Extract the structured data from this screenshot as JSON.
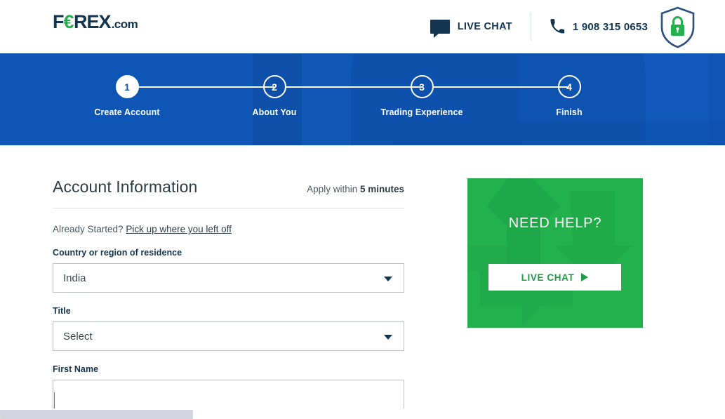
{
  "brand": {
    "logo_main_1": "F",
    "logo_euro": "€",
    "logo_main_2": "REX",
    "logo_dotcom": ".com",
    "blue": "#0e55b5",
    "navy": "#13354f",
    "green": "#22b14c"
  },
  "header": {
    "live_chat_label": "LIVE CHAT",
    "phone_number": "1 908 315 0653",
    "chat_icon": "chat-bubble-icon",
    "phone_icon": "phone-icon",
    "secure_icon": "shield-lock-icon"
  },
  "stepper": {
    "steps": [
      {
        "number": "1",
        "label": "Create Account",
        "active": true
      },
      {
        "number": "2",
        "label": "About You",
        "active": false
      },
      {
        "number": "3",
        "label": "Trading Experience",
        "active": false
      },
      {
        "number": "4",
        "label": "Finish",
        "active": false
      }
    ]
  },
  "form": {
    "title": "Account Information",
    "apply_prefix": "Apply within ",
    "apply_bold": "5 minutes",
    "already_started_text": "Already Started? ",
    "already_started_link": "Pick up where you left off",
    "fields": [
      {
        "label": "Country or region of residence",
        "type": "select",
        "value": "India",
        "placeholder": ""
      },
      {
        "label": "Title",
        "type": "select",
        "value": "Select",
        "placeholder": ""
      },
      {
        "label": "First Name",
        "type": "text",
        "value": "",
        "placeholder": ""
      }
    ]
  },
  "help_panel": {
    "title": "NEED HELP?",
    "button_label": "LIVE CHAT",
    "button_icon": "play-arrow-icon"
  }
}
